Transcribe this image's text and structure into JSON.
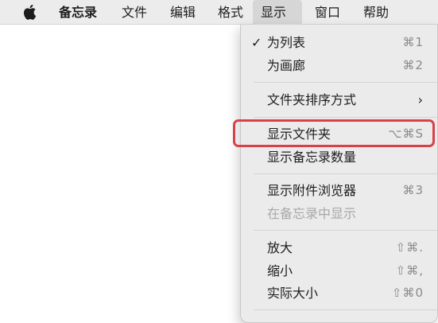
{
  "menubar": {
    "items": [
      {
        "label": "备忘录"
      },
      {
        "label": "文件"
      },
      {
        "label": "编辑"
      },
      {
        "label": "格式"
      },
      {
        "label": "显示"
      },
      {
        "label": "窗口"
      },
      {
        "label": "帮助"
      }
    ]
  },
  "menu": {
    "items": [
      {
        "label": "为列表",
        "shortcut": "⌘1",
        "check": "✓"
      },
      {
        "label": "为画廊",
        "shortcut": "⌘2"
      },
      {
        "label": "文件夹排序方式",
        "arrow": "›"
      },
      {
        "label": "显示文件夹",
        "shortcut": "⌥⌘S"
      },
      {
        "label": "显示备忘录数量"
      },
      {
        "label": "显示附件浏览器",
        "shortcut": "⌘3"
      },
      {
        "label": "在备忘录中显示"
      },
      {
        "label": "放大",
        "shortcut": "⇧⌘."
      },
      {
        "label": "缩小",
        "shortcut": "⇧⌘,"
      },
      {
        "label": "实际大小",
        "shortcut": "⇧⌘0"
      }
    ]
  },
  "colors": {
    "menubar_bg": "#ececec",
    "menu_bg": "#ebebeb",
    "highlight_border": "#d9414a",
    "shortcut_text": "#8a8a8a",
    "disabled_text": "#a8a8a8"
  }
}
